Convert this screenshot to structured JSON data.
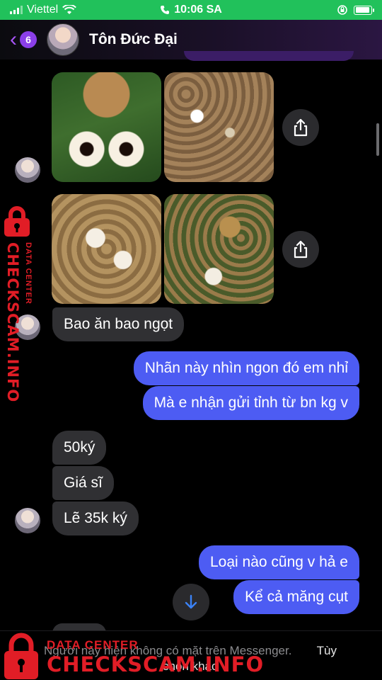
{
  "status_bar": {
    "carrier": "Viettel",
    "time": "10:06 SA"
  },
  "header": {
    "back_count": "6",
    "contact_name": "Tôn Đức Đại"
  },
  "messages": [
    {
      "from": "them",
      "text": "Bao ăn bao ngọt"
    },
    {
      "from": "me",
      "text": "Nhãn này nhìn ngon đó em nhỉ"
    },
    {
      "from": "me",
      "text": "Mà e nhận gửi tỉnh từ bn kg v"
    },
    {
      "from": "them",
      "text": "50ký"
    },
    {
      "from": "them",
      "text": "Giá sĩ"
    },
    {
      "from": "them",
      "text": "Lẽ 35k ký"
    },
    {
      "from": "me",
      "text": "Loại nào cũng v hả e"
    },
    {
      "from": "me",
      "text": "Kể cả măng cụt"
    }
  ],
  "footer": {
    "notice": "Người này hiện không có mặt trên Messenger.",
    "action_1": "Tùy",
    "action_2": "chọn khác"
  },
  "watermark": {
    "side_brand": "CHECKSCAM.INFO",
    "side_small": "DATA CENTER",
    "bottom_title": "DATA CENTER",
    "bottom_brand": "CHECKSCAM.INFO"
  },
  "colors": {
    "status_bar": "#21c15b",
    "accent": "#a855f7",
    "outgoing_bubble": "#4d5cf3",
    "incoming_bubble": "#303033",
    "watermark": "#e11d26"
  },
  "icons": [
    "back-chevron-icon",
    "share-icon",
    "arrow-down-icon",
    "wifi-icon",
    "phone-icon",
    "battery-icon",
    "lock-icon"
  ]
}
